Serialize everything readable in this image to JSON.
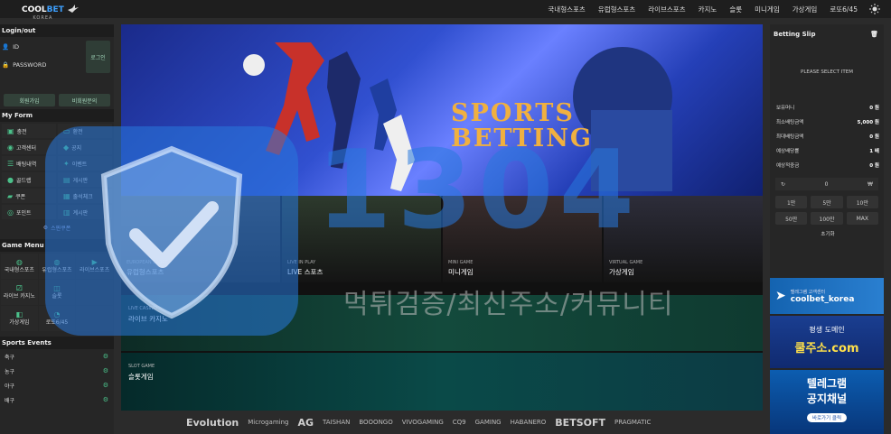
{
  "brand": {
    "name_a": "COOL",
    "name_b": "BET",
    "sub": "KOREA"
  },
  "nav": [
    "국내형스포츠",
    "유럽형스포츠",
    "라이브스포츠",
    "카지노",
    "슬롯",
    "미니게임",
    "가상게임",
    "로또6/45"
  ],
  "login": {
    "title": "Login/out",
    "id_label": "ID",
    "pw_label": "PASSWORD",
    "login_btn": "로그인",
    "join_btn": "회원가입",
    "inquiry_btn": "비회원문의"
  },
  "myform": {
    "title": "My Form",
    "items": [
      {
        "label": "충전",
        "icon": "wallet-icon"
      },
      {
        "label": "환전",
        "icon": "card-icon"
      },
      {
        "label": "고객센터",
        "icon": "headset-icon"
      },
      {
        "label": "공지",
        "icon": "bell-icon"
      },
      {
        "label": "배팅내역",
        "icon": "list-icon"
      },
      {
        "label": "이벤트",
        "icon": "gift-icon"
      },
      {
        "label": "골드렙",
        "icon": "coin-icon"
      },
      {
        "label": "게시판",
        "icon": "board-icon"
      },
      {
        "label": "쿠폰",
        "icon": "ticket-icon"
      },
      {
        "label": "출석체크",
        "icon": "calendar-icon"
      },
      {
        "label": "포인트",
        "icon": "point-icon"
      },
      {
        "label": "계시판",
        "icon": "doc-icon"
      }
    ],
    "coupon": "스핀쿠폰"
  },
  "gamemenu": {
    "title": "Game Menu",
    "items": [
      {
        "label": "국내형스포츠",
        "icon": "ball-icon"
      },
      {
        "label": "유럽형스포츠",
        "icon": "ball-icon"
      },
      {
        "label": "라이브스포츠",
        "icon": "live-icon"
      },
      {
        "label": "라이브 카지노",
        "icon": "dice-icon"
      },
      {
        "label": "슬롯",
        "icon": "slot-icon"
      },
      {
        "label": "",
        "icon": "blank"
      },
      {
        "label": "가상게임",
        "icon": "vr-icon"
      },
      {
        "label": "로또6/45",
        "icon": "lotto-icon"
      },
      {
        "label": "",
        "icon": "blank"
      }
    ]
  },
  "events": {
    "title": "Sports Events",
    "items": [
      "축구",
      "농구",
      "야구",
      "배구"
    ]
  },
  "hero": {
    "title_1": "SPORTS",
    "title_2": "BETTING"
  },
  "tiles": [
    {
      "en": "EUROPEAN SPORT",
      "ko": "유럽형스포츠"
    },
    {
      "en": "LIVE IN PLAY",
      "ko": "LIVE 스포츠"
    },
    {
      "en": "MINI GAME",
      "ko": "미니게임"
    },
    {
      "en": "VIRTUAL GAME",
      "ko": "가상게임"
    }
  ],
  "band1": {
    "en": "LIVE CASINO",
    "ko": "라이브 카지노"
  },
  "band2": {
    "en": "SLOT GAME",
    "ko": "슬롯게임"
  },
  "providers": [
    "Evolution",
    "Microgaming",
    "AG",
    "TAISHAN",
    "BOOONGO",
    "VIVOGAMING",
    "CQ9",
    "GAMING",
    "HABANERO",
    "BETSOFT",
    "PRAGMATIC"
  ],
  "betslip": {
    "title": "Betting Slip",
    "empty": "PLEASE SELECT ITEM",
    "rows": [
      {
        "label": "보유머니",
        "value": "0 원"
      },
      {
        "label": "최소배팅금액",
        "value": "5,000 원"
      },
      {
        "label": "최대배팅금액",
        "value": "0 원"
      },
      {
        "label": "예상배당률",
        "value": "1 배"
      },
      {
        "label": "예상적중금",
        "value": "0 원"
      }
    ],
    "input_value": "0",
    "currency": "₩",
    "chips": [
      "1만",
      "5만",
      "10만",
      "50만",
      "100만",
      "MAX"
    ],
    "reset": "초기화"
  },
  "banners": {
    "tg_small": "텔레그램 고객센터",
    "tg_big": "coolbet_korea",
    "dom_1": "평생 도메인",
    "dom_2": "쿨주소.com",
    "ch_1": "텔레그램",
    "ch_2": "공지채널",
    "ch_3": "바로가기 클릭"
  },
  "watermark": {
    "num": "1304",
    "text": "먹튀검증/최신주소/커뮤니티"
  }
}
